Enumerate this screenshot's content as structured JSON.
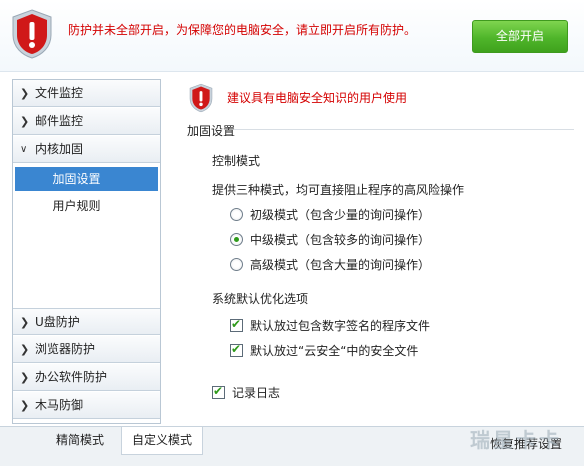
{
  "banner": {
    "message": "防护并未全部开启，为保障您的电脑安全，请立即开启所有防护。",
    "enable_all_label": "全部开启"
  },
  "sidebar": {
    "items": [
      {
        "label": "文件监控",
        "expanded": false
      },
      {
        "label": "邮件监控",
        "expanded": false
      },
      {
        "label": "内核加固",
        "expanded": true
      },
      {
        "label": "U盘防护",
        "expanded": false
      },
      {
        "label": "浏览器防护",
        "expanded": false
      },
      {
        "label": "办公软件防护",
        "expanded": false
      },
      {
        "label": "木马防御",
        "expanded": false
      }
    ],
    "subitems": [
      {
        "label": "加固设置",
        "active": true
      },
      {
        "label": "用户规则",
        "active": false
      }
    ]
  },
  "content": {
    "notice": "建议具有电脑安全知识的用户使用",
    "section_title": "加固设置",
    "control_mode": {
      "title": "控制模式",
      "description": "提供三种模式，均可直接阻止程序的高风险操作",
      "options": [
        {
          "label": "初级模式（包含少量的询问操作）",
          "selected": false
        },
        {
          "label": "中级模式（包含较多的询问操作）",
          "selected": true
        },
        {
          "label": "高级模式（包含大量的询问操作）",
          "selected": false
        }
      ]
    },
    "optimize": {
      "title": "系统默认优化选项",
      "options": [
        {
          "label": "默认放过包含数字签名的程序文件",
          "checked": true
        },
        {
          "label": "默认放过“云安全“中的安全文件",
          "checked": true
        }
      ]
    },
    "log": {
      "label": "记录日志",
      "checked": true
    }
  },
  "bottom": {
    "tabs": [
      {
        "label": "精简模式",
        "active": false
      },
      {
        "label": "自定义模式",
        "active": true
      }
    ],
    "restore_label": "恢复推荐设置",
    "watermark": "瑞星卡卡"
  },
  "colors": {
    "warning_red": "#d40000",
    "accent_blue": "#3a86d1",
    "button_green": "#4fb52a"
  }
}
